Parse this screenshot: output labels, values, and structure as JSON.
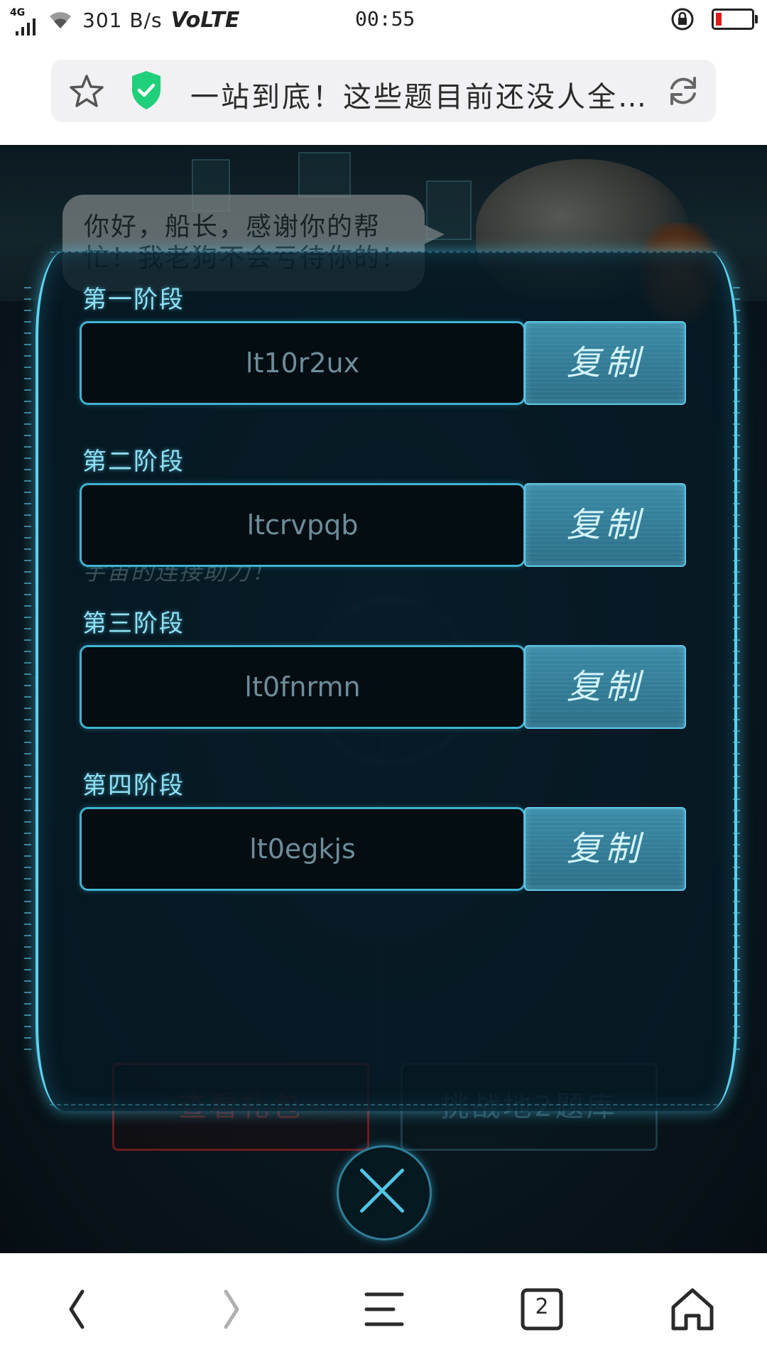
{
  "status_bar": {
    "network": "4G",
    "speed": "301 B/s",
    "volte": "VoLTE",
    "time": "00:55"
  },
  "address_bar": {
    "title": "一站到底！这些题目前还没人全…"
  },
  "game": {
    "speech_bubble": "你好，船长，感谢你的帮忙！我老狗不会亏待你的！",
    "background_text": "宇宙的连接助力！",
    "stages": [
      {
        "label": "第一阶段",
        "code": "lt10r2ux",
        "copy_label": "复制"
      },
      {
        "label": "第二阶段",
        "code": "ltcrvpqb",
        "copy_label": "复制"
      },
      {
        "label": "第三阶段",
        "code": "lt0fnrmn",
        "copy_label": "复制"
      },
      {
        "label": "第四阶段",
        "code": "lt0egkjs",
        "copy_label": "复制"
      }
    ],
    "under_buttons": {
      "view_gift": "查看礼包",
      "challenge": "挑战地2题库"
    }
  },
  "bottom_nav": {
    "tabs_count": "2"
  },
  "colors": {
    "accent": "#5ad4f2",
    "copy_button": "#2c6f88",
    "stage_label": "#8fe0f5"
  }
}
